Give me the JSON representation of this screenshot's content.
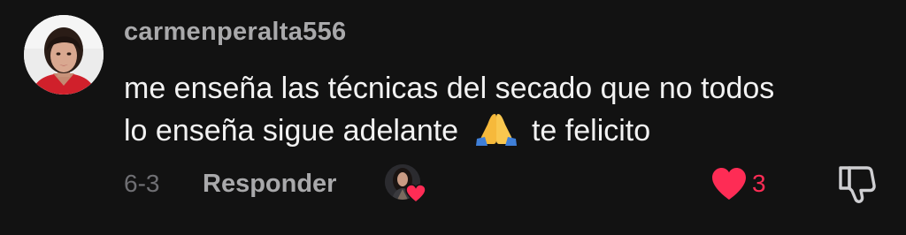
{
  "comment": {
    "username": "carmenperalta556",
    "text_line1": "me enseña las técnicas del secado que no todos",
    "text_line2_before": "lo enseña sigue adelante",
    "text_line2_emoji": "🙏",
    "text_line2_after": "te felicito",
    "date": "6-3",
    "reply_label": "Responder",
    "like_count": "3",
    "liked": true,
    "liked_by_creator": true
  },
  "colors": {
    "background": "#121212",
    "username": "#a9a9ab",
    "text": "#f2f2f2",
    "muted": "#6f6f73",
    "accent_like": "#fe2c55"
  },
  "icons": {
    "avatar": "user-avatar-photo",
    "creator_avatar": "creator-avatar-photo",
    "creator_heart": "heart-filled-icon",
    "like": "heart-filled-icon",
    "dislike": "thumbs-down-icon",
    "emoji": "folded-hands-emoji"
  }
}
